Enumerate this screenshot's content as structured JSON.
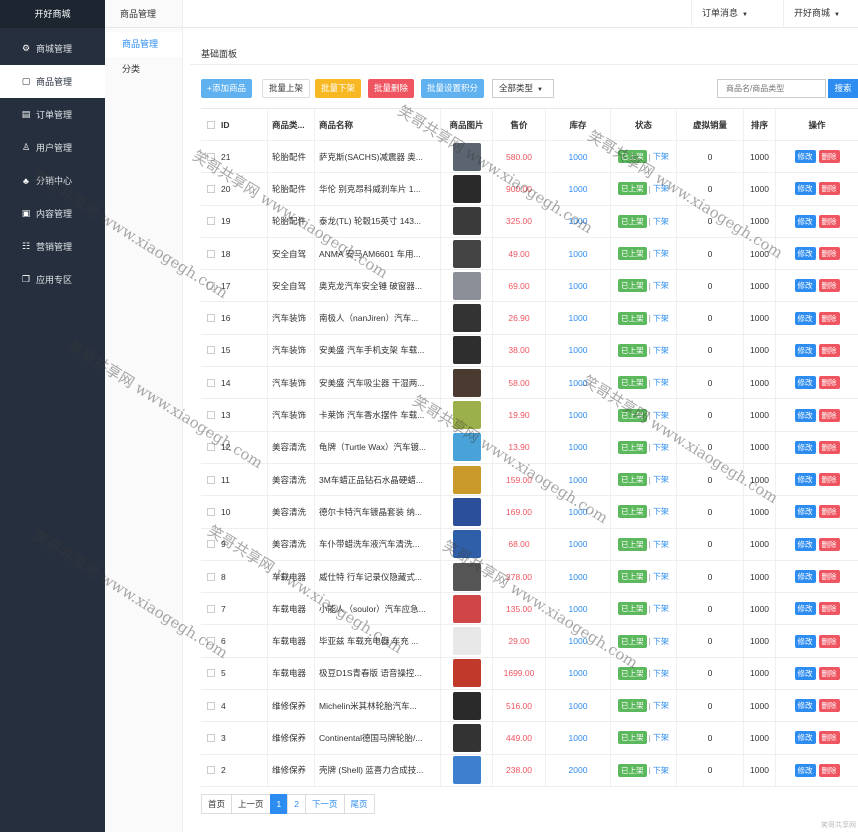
{
  "brand": "开好商城",
  "menu": [
    {
      "label": "商城管理",
      "icon": "gear-icon",
      "glyph": "⚙"
    },
    {
      "label": "商品管理",
      "icon": "bag-icon",
      "glyph": "▢",
      "active": true
    },
    {
      "label": "订单管理",
      "icon": "list-icon",
      "glyph": "▤"
    },
    {
      "label": "用户管理",
      "icon": "user-icon",
      "glyph": "♙"
    },
    {
      "label": "分销中心",
      "icon": "sitemap-icon",
      "glyph": "♣"
    },
    {
      "label": "内容管理",
      "icon": "document-icon",
      "glyph": "▣"
    },
    {
      "label": "营销管理",
      "icon": "marketing-icon",
      "glyph": "☷"
    },
    {
      "label": "应用专区",
      "icon": "apps-icon",
      "glyph": "❐"
    }
  ],
  "subnav": {
    "title": "商品管理",
    "items": [
      {
        "label": "商品管理",
        "active": true
      },
      {
        "label": "分类"
      }
    ]
  },
  "topbar": {
    "orders": "订单消息",
    "shop": "开好商城"
  },
  "panel_title": "基础面板",
  "toolbar": {
    "add": "+添加商品",
    "bulk_on": "批量上架",
    "bulk_off": "批量下架",
    "bulk_delete": "批量删除",
    "bulk_points": "批量设置积分",
    "type_select": "全部类型",
    "search_placeholder": "商品名/商品类型",
    "search": "搜索"
  },
  "table": {
    "headers": [
      "ID",
      "商品类...",
      "商品名称",
      "商品图片",
      "售价",
      "库存",
      "状态",
      "虚拟销量",
      "排序",
      "操作"
    ],
    "status_on": "已上架",
    "status_sep": "|",
    "status_off": "下架",
    "edit": "修改",
    "delete": "删除",
    "rows": [
      {
        "id": "21",
        "cat": "轮胎配件",
        "name": "萨克斯(SACHS)减震器 奥...",
        "price": "580.00",
        "stock": "1000",
        "virtual": "0",
        "sort": "1000",
        "img": "#5b6470"
      },
      {
        "id": "20",
        "cat": "轮胎配件",
        "name": "华伦 别克昂科威刹车片 1...",
        "price": "900.00",
        "stock": "1000",
        "virtual": "0",
        "sort": "1000",
        "img": "#2a2a2a"
      },
      {
        "id": "19",
        "cat": "轮胎配件",
        "name": "泰龙(TL) 轮毂15英寸 143...",
        "price": "325.00",
        "stock": "1000",
        "virtual": "0",
        "sort": "1000",
        "img": "#3a3a3a"
      },
      {
        "id": "18",
        "cat": "安全自驾",
        "name": "ANMA 安马AM6601 车用...",
        "price": "49.00",
        "stock": "1000",
        "virtual": "0",
        "sort": "1000",
        "img": "#444444"
      },
      {
        "id": "17",
        "cat": "安全自驾",
        "name": "奥克龙汽车安全锤 破窗器...",
        "price": "69.00",
        "stock": "1000",
        "virtual": "0",
        "sort": "1000",
        "img": "#8a8f98"
      },
      {
        "id": "16",
        "cat": "汽车装饰",
        "name": "南极人（nanJiren）汽车...",
        "price": "26.90",
        "stock": "1000",
        "virtual": "0",
        "sort": "1000",
        "img": "#333333"
      },
      {
        "id": "15",
        "cat": "汽车装饰",
        "name": "安美盛 汽车手机支架 车载...",
        "price": "38.00",
        "stock": "1000",
        "virtual": "0",
        "sort": "1000",
        "img": "#2e2e2e"
      },
      {
        "id": "14",
        "cat": "汽车装饰",
        "name": "安美盛 汽车吸尘器 干湿两...",
        "price": "58.00",
        "stock": "1000",
        "virtual": "0",
        "sort": "1000",
        "img": "#4a3a30"
      },
      {
        "id": "13",
        "cat": "汽车装饰",
        "name": "卡莱饰 汽车香水摆件 车载...",
        "price": "19.90",
        "stock": "1000",
        "virtual": "0",
        "sort": "1000",
        "img": "#9bb04a"
      },
      {
        "id": "12",
        "cat": "美容清洗",
        "name": "龟牌（Turtle Wax）汽车镀...",
        "price": "13.90",
        "stock": "1000",
        "virtual": "0",
        "sort": "1000",
        "img": "#4aa3d8"
      },
      {
        "id": "11",
        "cat": "美容清洗",
        "name": "3M车蜡正品钻石水晶硬蜡...",
        "price": "159.00",
        "stock": "1000",
        "virtual": "0",
        "sort": "1000",
        "img": "#c99a2a"
      },
      {
        "id": "10",
        "cat": "美容清洗",
        "name": "德尔卡特汽车镀晶套装 纳...",
        "price": "169.00",
        "stock": "1000",
        "virtual": "0",
        "sort": "1000",
        "img": "#2b4f9a"
      },
      {
        "id": "9",
        "cat": "美容清洗",
        "name": "车仆带蜡洗车液汽车清洗...",
        "price": "68.00",
        "stock": "1000",
        "virtual": "0",
        "sort": "1000",
        "img": "#2f5fa8"
      },
      {
        "id": "8",
        "cat": "车载电器",
        "name": "威仕特 行车记录仪隐藏式...",
        "price": "278.00",
        "stock": "1000",
        "virtual": "0",
        "sort": "1000",
        "img": "#555555"
      },
      {
        "id": "7",
        "cat": "车载电器",
        "name": "小能人（soulor）汽车应急...",
        "price": "135.00",
        "stock": "1000",
        "virtual": "0",
        "sort": "1000",
        "img": "#d04545"
      },
      {
        "id": "6",
        "cat": "车载电器",
        "name": "毕亚兹 车载充电器 车充 ...",
        "price": "29.00",
        "stock": "1000",
        "virtual": "0",
        "sort": "1000",
        "img": "#e8e8e8"
      },
      {
        "id": "5",
        "cat": "车载电器",
        "name": "极豆D1S青春版 语音操控...",
        "price": "1699.00",
        "stock": "1000",
        "virtual": "0",
        "sort": "1000",
        "img": "#c0392b"
      },
      {
        "id": "4",
        "cat": "维修保养",
        "name": "Michelin米其林轮胎汽车...",
        "price": "516.00",
        "stock": "1000",
        "virtual": "0",
        "sort": "1000",
        "img": "#2a2a2a"
      },
      {
        "id": "3",
        "cat": "维修保养",
        "name": "Continental德国马牌轮胎/...",
        "price": "449.00",
        "stock": "1000",
        "virtual": "0",
        "sort": "1000",
        "img": "#333333"
      },
      {
        "id": "2",
        "cat": "维修保养",
        "name": "壳牌 (Shell) 蓝喜力合成技...",
        "price": "238.00",
        "stock": "2000",
        "virtual": "0",
        "sort": "1000",
        "img": "#3f7fcf"
      }
    ]
  },
  "pager": {
    "first": "首页",
    "prev": "上一页",
    "pages": [
      "1",
      "2"
    ],
    "next": "下一页",
    "last": "尾页"
  },
  "watermark": "笑哥共享网 www.xiaogegh.com",
  "corner_mark": "笑哥共享网"
}
